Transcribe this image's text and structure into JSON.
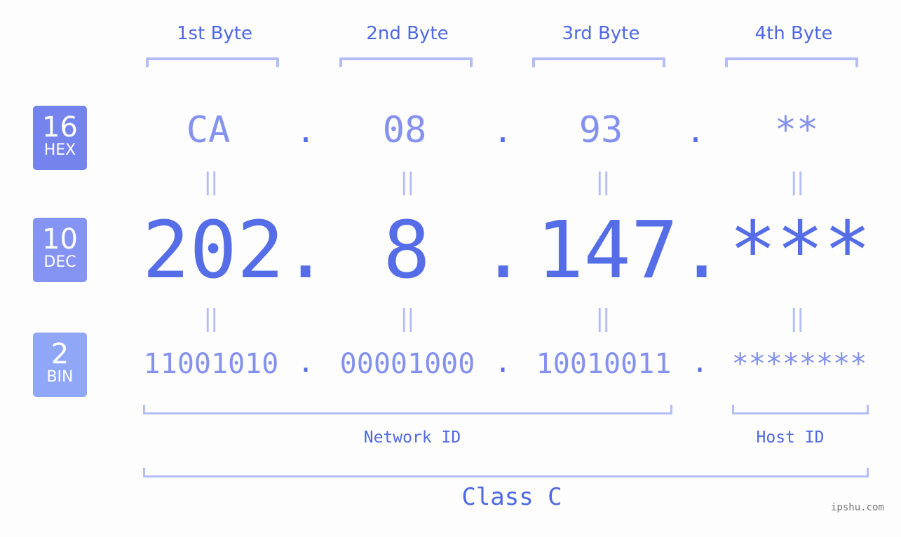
{
  "bytes": {
    "labels": [
      "1st Byte",
      "2nd Byte",
      "3rd Byte",
      "4th Byte"
    ]
  },
  "bases": [
    {
      "radix": "16",
      "name": "HEX",
      "color": "#7584ec"
    },
    {
      "radix": "10",
      "name": "DEC",
      "color": "#8594f2"
    },
    {
      "radix": "2",
      "name": "BIN",
      "color": "#90a7f8"
    }
  ],
  "hex": {
    "octets": [
      "CA",
      "08",
      "93",
      "**"
    ],
    "separator": "."
  },
  "dec": {
    "octets": [
      "202",
      "8",
      "147",
      "***"
    ],
    "separator": "."
  },
  "bin": {
    "octets": [
      "11001010",
      "00001000",
      "10010011",
      "********"
    ],
    "separator": "."
  },
  "equals_glyph": "||",
  "segments": {
    "network_label": "Network ID",
    "host_label": "Host ID",
    "class_label": "Class C"
  },
  "watermark": "ipshu.com",
  "colors": {
    "accent": "#566de8",
    "light_accent": "#8491ee",
    "bracket": "#b4bdf8"
  }
}
